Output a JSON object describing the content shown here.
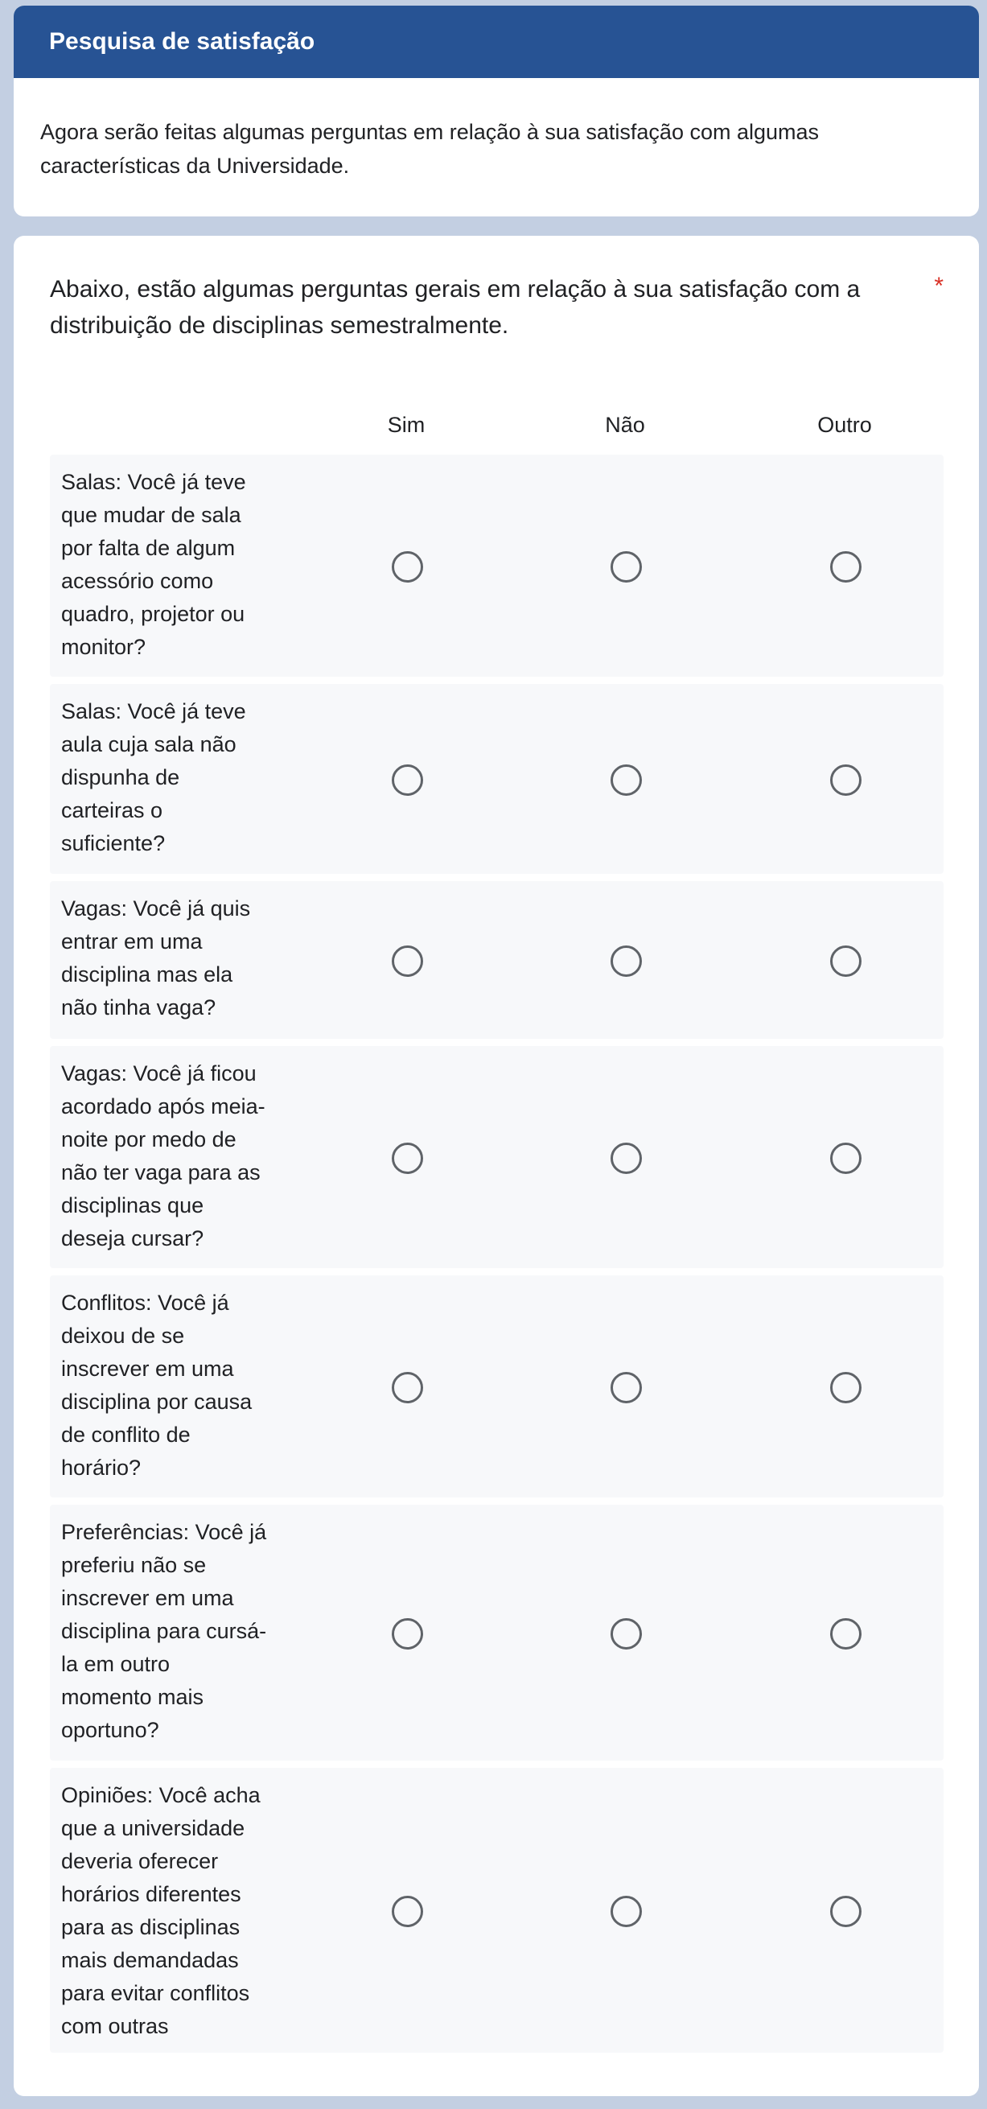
{
  "header": {
    "title": "Pesquisa de satisfação",
    "description": "Agora serão feitas algumas perguntas em relação à sua satisfação com algumas características da Universidade."
  },
  "question": {
    "title": "Abaixo, estão algumas perguntas gerais em relação à sua satisfação com a distribuição de disciplinas semestralmente.",
    "required_marker": "*",
    "columns": [
      "Sim",
      "Não",
      "Outro"
    ],
    "rows": [
      {
        "label": "Salas: Você já teve\nque mudar de sala\npor falta de algum\nacessório como\nquadro, projetor ou\nmonitor?",
        "selected": null
      },
      {
        "label": "Salas: Você já teve\naula cuja sala não\ndispunha de\ncarteiras o\nsuficiente?",
        "selected": null
      },
      {
        "label": "Vagas: Você já quis\nentrar em uma\ndisciplina mas ela\nnão tinha vaga?",
        "selected": null
      },
      {
        "label": "Vagas: Você já ficou\nacordado após meia-\nnoite por medo de\nnão ter vaga para as\ndisciplinas que\ndeseja cursar?",
        "selected": null
      },
      {
        "label": "Conflitos: Você já\ndeixou de se\ninscrever em uma\ndisciplina por causa\nde conflito de\nhorário?",
        "selected": null
      },
      {
        "label": "Preferências: Você já\npreferiu não se\ninscrever em uma\ndisciplina para cursá-\nla em outro\nmomento mais\noportuno?",
        "selected": null
      },
      {
        "label": "Opiniões: Você acha\nque a universidade\ndeveria oferecer\nhorários diferentes\npara as disciplinas\nmais demandadas\npara evitar conflitos\ncom outras",
        "selected": null
      }
    ]
  }
}
